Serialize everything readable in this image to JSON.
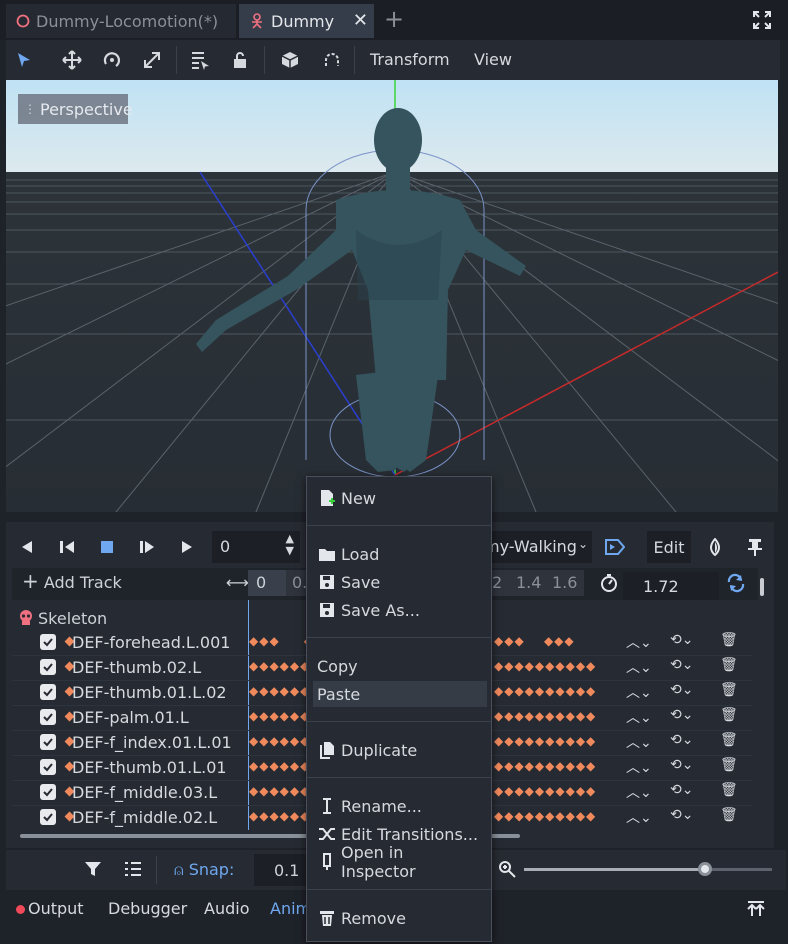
{
  "tabs": [
    {
      "label": "Dummy-Locomotion(*)",
      "active": false
    },
    {
      "label": "Dummy",
      "active": true
    }
  ],
  "toolbar": {
    "menus": [
      "Transform",
      "View"
    ]
  },
  "viewport": {
    "perspective_label": "Perspective"
  },
  "animation": {
    "frame_value": "0",
    "animation_name": "my-Walking",
    "edit_label": "Edit",
    "add_track_label": "Add Track",
    "timeline_ticks_left": [
      "0",
      "0.2"
    ],
    "timeline_ticks_right": [
      "2",
      "1.4",
      "1.6"
    ],
    "length_value": "1.72",
    "group_label": "Skeleton",
    "tracks": [
      "DEF-forehead.L.001",
      "DEF-thumb.02.L",
      "DEF-thumb.01.L.02",
      "DEF-palm.01.L",
      "DEF-f_index.01.L.01",
      "DEF-thumb.01.L.01",
      "DEF-f_middle.03.L",
      "DEF-f_middle.02.L"
    ]
  },
  "bottom": {
    "snap_label": "Snap:",
    "snap_value": "0.1",
    "zoom_fraction": 0.73
  },
  "status_tabs": [
    "Output",
    "Debugger",
    "Audio",
    "Anim"
  ],
  "context_menu": {
    "items": [
      {
        "label": "New",
        "icon": "new-file-icon"
      },
      {
        "label": "Load",
        "icon": "folder-icon"
      },
      {
        "label": "Save",
        "icon": "save-icon"
      },
      {
        "label": "Save As...",
        "icon": "save-as-icon"
      },
      {
        "label": "Copy",
        "icon": ""
      },
      {
        "label": "Paste",
        "icon": "",
        "highlighted": true
      },
      {
        "label": "Duplicate",
        "icon": "duplicate-icon"
      },
      {
        "label": "Rename...",
        "icon": "rename-icon"
      },
      {
        "label": "Edit Transitions...",
        "icon": "transitions-icon"
      },
      {
        "label": "Open in Inspector",
        "icon": "inspector-icon"
      },
      {
        "label": "Remove",
        "icon": "trash-icon"
      }
    ]
  },
  "colors": {
    "accent": "#6fa8f0",
    "keyframe": "#f08a5d",
    "axis_x": "#c82a2a",
    "axis_y": "#3bd33b",
    "axis_z": "#2a3fd0",
    "error_dot": "#f04a5a"
  }
}
